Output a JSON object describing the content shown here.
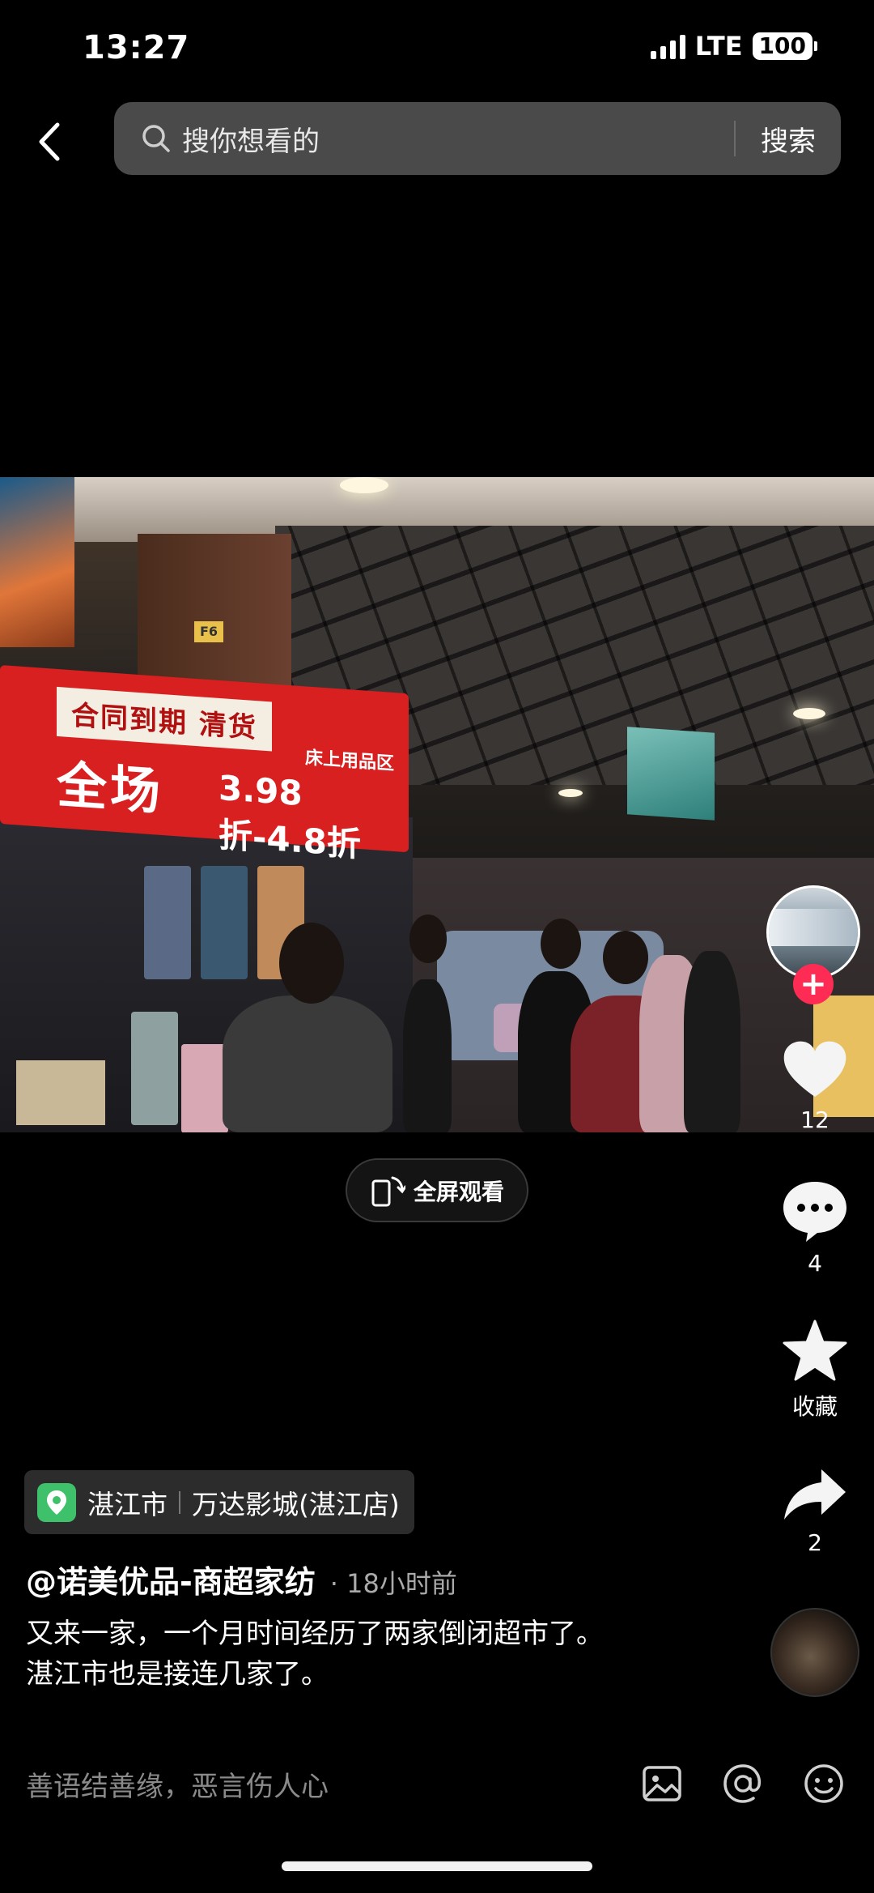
{
  "status_bar": {
    "time": "13:27",
    "network": "LTE",
    "battery": "100"
  },
  "header": {
    "search_placeholder": "搜你想看的",
    "search_button": "搜索"
  },
  "video": {
    "sign_line1": "合同到期 清货",
    "sign_line2": "全场",
    "sign_line3": "3.98折-4.8折",
    "sign_area": "床上用品区"
  },
  "fullscreen": {
    "label": "全屏观看"
  },
  "actions": {
    "likes": "12",
    "comments": "4",
    "favorite_label": "收藏",
    "shares": "2"
  },
  "location": {
    "city": "湛江市",
    "place": "万达影城(湛江店)"
  },
  "post": {
    "author": "@诺美优品-商超家纺",
    "time": "· 18小时前",
    "caption_line1": "又来一家，一个月时间经历了两家倒闭超市了。",
    "caption_line2": "湛江市也是接连几家了。"
  },
  "comment_bar": {
    "placeholder": "善语结善缘，恶言伤人心"
  },
  "colors": {
    "accent": "#fe2c55",
    "location_pin": "#3fc06a"
  },
  "icons": [
    "back-icon",
    "search-icon",
    "fullscreen-icon",
    "heart-icon",
    "comment-icon",
    "star-icon",
    "share-icon",
    "image-icon",
    "at-icon",
    "emoji-icon",
    "location-pin-icon"
  ]
}
